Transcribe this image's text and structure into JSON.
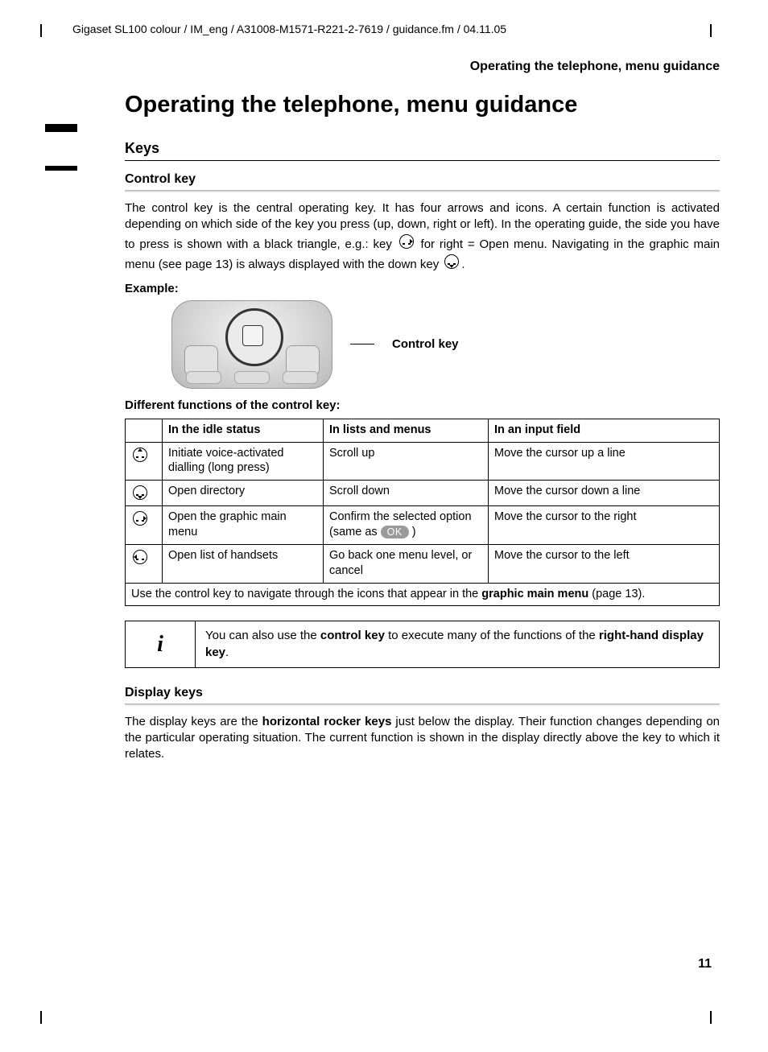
{
  "header": {
    "doc_path": "Gigaset SL100 colour / IM_eng / A31008-M1571-R221-2-7619 / guidance.fm / 04.11.05",
    "running_head": "Operating the telephone, menu guidance"
  },
  "title": "Operating the telephone, menu guidance",
  "keys_section": {
    "heading": "Keys",
    "control_key": {
      "heading": "Control key",
      "para_before": "The control key is the central operating key. It has four arrows and icons. A certain function is activated depending on which side of the key you press (up, down, right or left). In the operating guide, the side you have to press is shown with a black triangle, e.g.: key ",
      "para_mid": " for right = Open menu. Navigating in the graphic main menu (see page 13) is always displayed with the down key ",
      "para_end": ".",
      "example_label": "Example:",
      "pointer_label": "Control key",
      "func_heading": "Different functions of the control key:",
      "table": {
        "headers": [
          "",
          "In the idle status",
          "In lists and menus",
          "In an input field"
        ],
        "rows": [
          {
            "dir": "up",
            "idle": "Initiate voice-activated dialling\n(long press)",
            "lists": "Scroll up",
            "input": "Move the cursor up a line"
          },
          {
            "dir": "down",
            "idle": "Open directory",
            "lists": "Scroll down",
            "input": "Move the cursor down a line"
          },
          {
            "dir": "right",
            "idle": "Open the graphic main menu",
            "lists_before": "Confirm the selected option (same as ",
            "lists_badge": "OK",
            "lists_after": " )",
            "input": "Move the cursor to the right"
          },
          {
            "dir": "left",
            "idle": "Open list of handsets",
            "lists": "Go back one menu level, or cancel",
            "input": "Move the cursor to the left"
          }
        ],
        "footer_before": "Use the control key to navigate through the icons that appear in the ",
        "footer_bold": "graphic main menu",
        "footer_after": " (page 13)."
      },
      "info_box": {
        "icon": "i",
        "text_before": "You can also use the ",
        "bold1": "control key",
        "text_mid": " to execute many of the functions of the ",
        "bold2": "right-hand display key",
        "text_after": "."
      }
    },
    "display_keys": {
      "heading": "Display keys",
      "para_before": "The display keys are the ",
      "bold": "horizontal rocker keys",
      "para_after": " just below the display. Their function changes depending on the particular operating situation. The current function is shown in the display directly above the key to which it relates."
    }
  },
  "page_number": "11"
}
